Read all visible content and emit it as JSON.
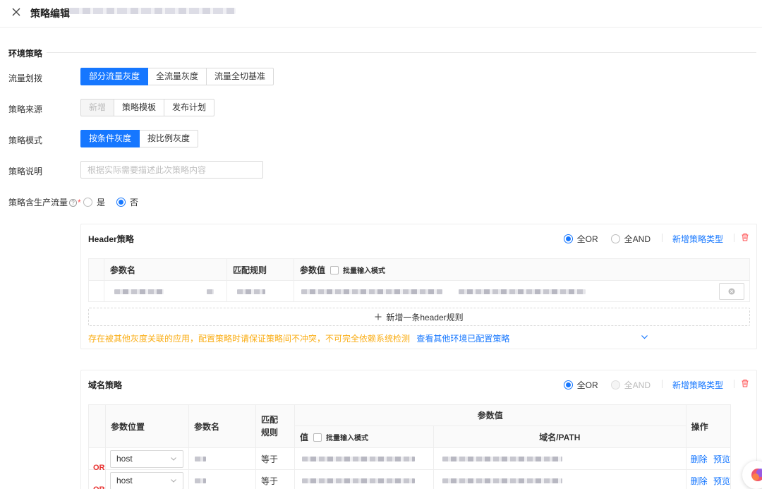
{
  "topbar": {
    "title": "策略编辑"
  },
  "section": {
    "title": "环境策略"
  },
  "traffic": {
    "label": "流量划拨",
    "options": [
      "部分流量灰度",
      "全流量灰度",
      "流量全切基准"
    ],
    "active": 0
  },
  "source": {
    "label": "策略来源",
    "options": [
      "新增",
      "策略模板",
      "发布计划"
    ],
    "disabled": 0
  },
  "mode": {
    "label": "策略模式",
    "options": [
      "按条件灰度",
      "按比例灰度"
    ],
    "active": 0
  },
  "desc": {
    "label": "策略说明",
    "placeholder": "根据实际需要描述此次策略内容"
  },
  "prod": {
    "label": "策略含生产流量",
    "required_mark": "*",
    "yes": "是",
    "no": "否",
    "selected": "否"
  },
  "header_policy": {
    "title": "Header策略",
    "radio_or": "全OR",
    "radio_and": "全AND",
    "selected": "全OR",
    "add_type": "新增策略类型",
    "columns": {
      "param_name": "参数名",
      "match_rule": "匹配规则",
      "param_value": "参数值",
      "bulk_mode": "批量输入模式"
    },
    "add_row": "新增一条header规则",
    "warning": "存在被其他灰度关联的应用，配置策略时请保证策略间不冲突，不可完全依赖系统检测",
    "view_link": "查看其他环境已配置策略"
  },
  "domain_policy": {
    "title": "域名策略",
    "radio_or": "全OR",
    "radio_and": "全AND",
    "selected": "全OR",
    "add_type": "新增策略类型",
    "columns": {
      "param_position": "参数位置",
      "param_name": "参数名",
      "match_rule": "匹配规则",
      "param_value": "参数值",
      "value": "值",
      "bulk_mode": "批量输入模式",
      "domain_path": "域名/PATH",
      "operation": "操作"
    },
    "rows": [
      {
        "logic": "OR",
        "position": "host",
        "match": "等于",
        "delete": "删除",
        "preview": "预览"
      },
      {
        "logic": "OR",
        "position": "host",
        "match": "等于",
        "delete": "删除",
        "preview": "预览"
      }
    ]
  },
  "colors": {
    "primary": "#1677ff",
    "warning": "#faad14",
    "danger": "#ff4d4f",
    "or_tag": "#e8312f"
  }
}
